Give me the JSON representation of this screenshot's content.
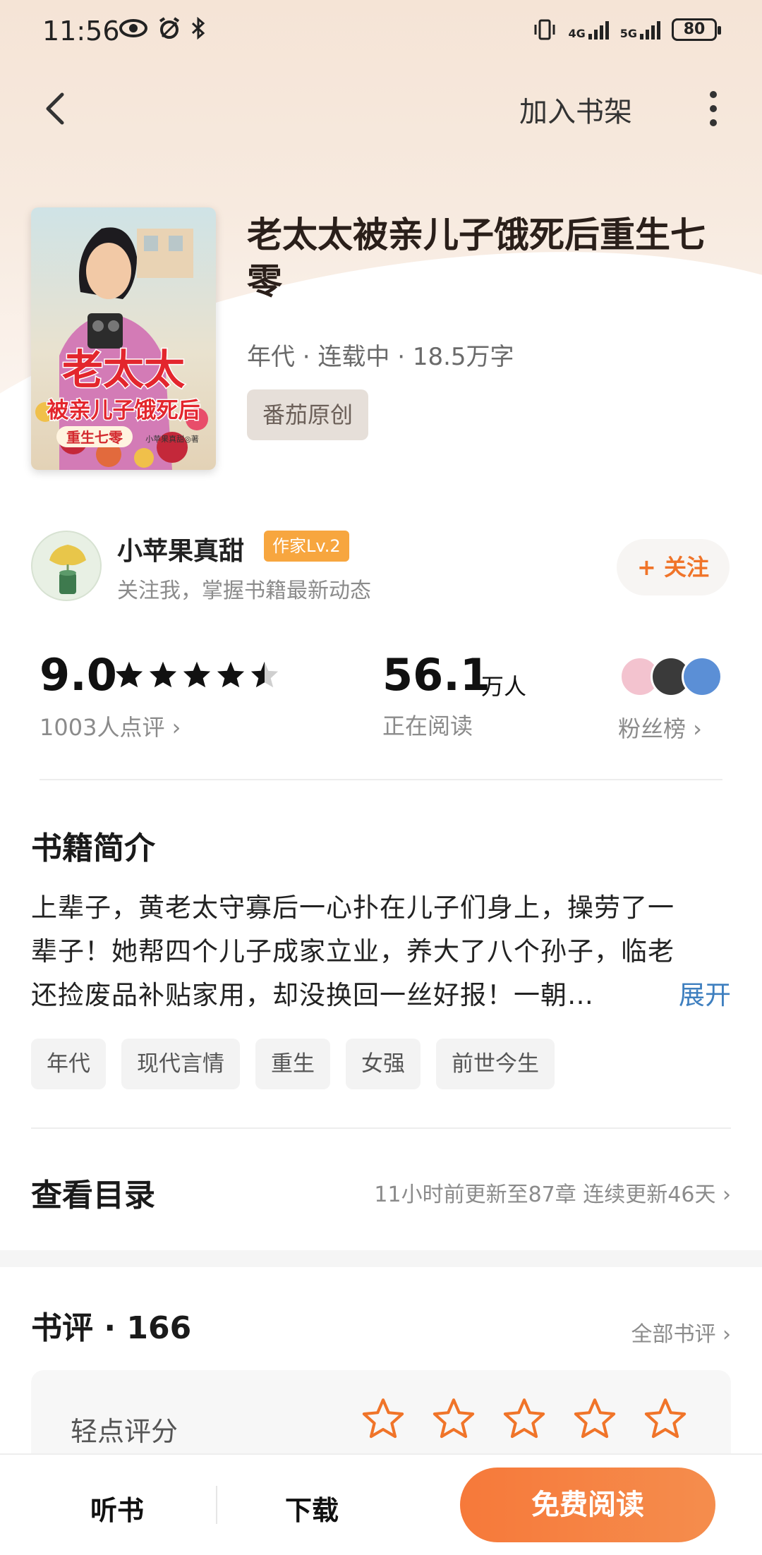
{
  "status_bar": {
    "time": "11:56",
    "net1": "4G",
    "net2": "5G",
    "battery": "80"
  },
  "nav": {
    "add_shelf": "加入书架"
  },
  "book": {
    "title": "老太太被亲儿子饿死后重生七零",
    "meta": "年代 · 连载中 · 18.5万字",
    "source_tag": "番茄原创",
    "cover_text": {
      "line1": "老太太",
      "line2": "被亲儿子饿死后",
      "line3": "重生七零",
      "author": "小苹果真甜◎著"
    }
  },
  "author": {
    "name": "小苹果真甜",
    "level": "作家Lv.2",
    "desc": "关注我，掌握书籍最新动态",
    "follow": "+ 关注"
  },
  "stats": {
    "rating": "9.0",
    "rating_stars": 4.5,
    "rating_count": "1003人点评 ›",
    "reading": "56.1",
    "reading_unit": "万人",
    "reading_label": "正在阅读",
    "fans_label": "粉丝榜 ›"
  },
  "intro": {
    "title": "书籍简介",
    "line1": "上辈子，黄老太守寡后一心扑在儿子们身上，操劳了一",
    "line2": "辈子！她帮四个儿子成家立业，养大了八个孙子，临老",
    "line3": "还捡废品补贴家用，却没换回一丝好报！一朝…",
    "expand": "展开",
    "tags": [
      "年代",
      "现代言情",
      "重生",
      "女强",
      "前世今生"
    ]
  },
  "catalog": {
    "title": "查看目录",
    "info": "11小时前更新至87章 连续更新46天 ›"
  },
  "reviews": {
    "title": "书评 · 166",
    "all": "全部书评 ›",
    "rate_label": "轻点评分"
  },
  "bottom": {
    "listen": "听书",
    "download": "下载",
    "read": "免费阅读"
  },
  "colors": {
    "accent": "#F07429",
    "link": "#3E7FBF",
    "level_badge": "#F7A63F"
  }
}
